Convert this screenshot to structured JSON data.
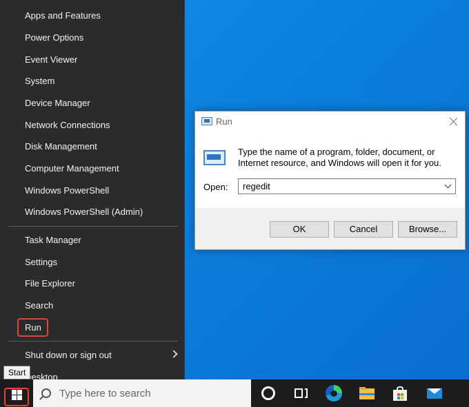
{
  "start_menu": {
    "items": [
      {
        "label": "Apps and Features",
        "name": "menu-item-apps-and-features"
      },
      {
        "label": "Power Options",
        "name": "menu-item-power-options"
      },
      {
        "label": "Event Viewer",
        "name": "menu-item-event-viewer"
      },
      {
        "label": "System",
        "name": "menu-item-system"
      },
      {
        "label": "Device Manager",
        "name": "menu-item-device-manager"
      },
      {
        "label": "Network Connections",
        "name": "menu-item-network-connections"
      },
      {
        "label": "Disk Management",
        "name": "menu-item-disk-management"
      },
      {
        "label": "Computer Management",
        "name": "menu-item-computer-management"
      },
      {
        "label": "Windows PowerShell",
        "name": "menu-item-windows-powershell"
      },
      {
        "label": "Windows PowerShell (Admin)",
        "name": "menu-item-windows-powershell-admin"
      },
      {
        "label": "Task Manager",
        "name": "menu-item-task-manager"
      },
      {
        "label": "Settings",
        "name": "menu-item-settings"
      },
      {
        "label": "File Explorer",
        "name": "menu-item-file-explorer"
      },
      {
        "label": "Search",
        "name": "menu-item-search"
      },
      {
        "label": "Run",
        "name": "menu-item-run"
      },
      {
        "label": "Shut down or sign out",
        "name": "menu-item-shut-down"
      },
      {
        "label": "Desktop",
        "name": "menu-item-desktop"
      }
    ]
  },
  "tooltip": {
    "text": "Start"
  },
  "taskbar": {
    "search_placeholder": "Type here to search",
    "icons": [
      "windows-start-icon",
      "cortana-icon",
      "task-view-icon",
      "edge-icon",
      "file-explorer-icon",
      "store-icon",
      "mail-icon"
    ]
  },
  "run_dialog": {
    "title": "Run",
    "description": "Type the name of a program, folder, document, or Internet resource, and Windows will open it for you.",
    "open_label": "Open:",
    "open_value": "regedit",
    "ok_label": "OK",
    "cancel_label": "Cancel",
    "browse_label": "Browse..."
  },
  "colors": {
    "highlight_box": "#e0443a",
    "menu_background": "#2b2b2b",
    "desktop_blue": "#0b7fdc"
  }
}
